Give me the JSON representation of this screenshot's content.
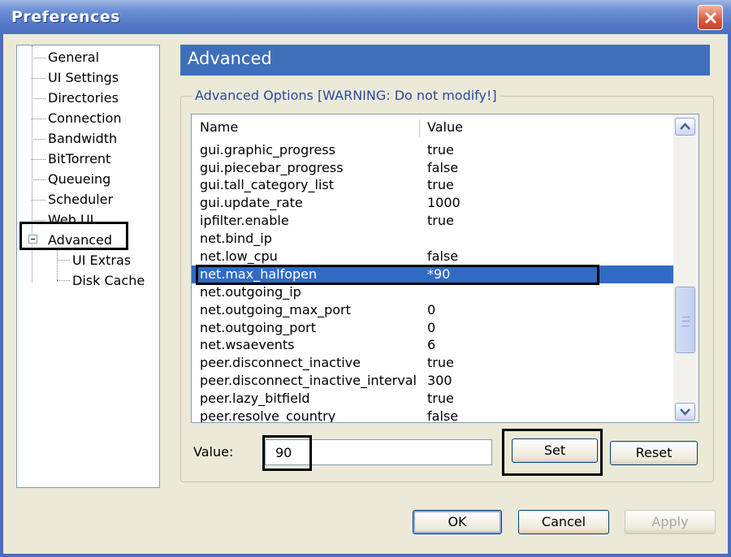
{
  "window": {
    "title": "Preferences"
  },
  "tree": {
    "items": [
      {
        "label": "General"
      },
      {
        "label": "UI Settings"
      },
      {
        "label": "Directories"
      },
      {
        "label": "Connection"
      },
      {
        "label": "Bandwidth"
      },
      {
        "label": "BitTorrent"
      },
      {
        "label": "Queueing"
      },
      {
        "label": "Scheduler"
      },
      {
        "label": "Web UI"
      },
      {
        "label": "Advanced"
      },
      {
        "label": "UI Extras"
      },
      {
        "label": "Disk Cache"
      }
    ]
  },
  "panel": {
    "title": "Advanced",
    "group_label": "Advanced Options [WARNING: Do not modify!]",
    "columns": {
      "name": "Name",
      "value": "Value"
    },
    "rows": [
      {
        "name": "gui.graphic_progress",
        "value": "true"
      },
      {
        "name": "gui.piecebar_progress",
        "value": "false"
      },
      {
        "name": "gui.tall_category_list",
        "value": "true"
      },
      {
        "name": "gui.update_rate",
        "value": "1000"
      },
      {
        "name": "ipfilter.enable",
        "value": "true"
      },
      {
        "name": "net.bind_ip",
        "value": ""
      },
      {
        "name": "net.low_cpu",
        "value": "false"
      },
      {
        "name": "net.max_halfopen",
        "value": "*90",
        "selected": true
      },
      {
        "name": "net.outgoing_ip",
        "value": ""
      },
      {
        "name": "net.outgoing_max_port",
        "value": "0"
      },
      {
        "name": "net.outgoing_port",
        "value": "0"
      },
      {
        "name": "net.wsaevents",
        "value": "6"
      },
      {
        "name": "peer.disconnect_inactive",
        "value": "true"
      },
      {
        "name": "peer.disconnect_inactive_interval",
        "value": "300"
      },
      {
        "name": "peer.lazy_bitfield",
        "value": "true"
      },
      {
        "name": "peer.resolve_country",
        "value": "false"
      }
    ],
    "value_label": "Value:",
    "value_input": "90",
    "set_button": "Set",
    "reset_button": "Reset"
  },
  "footer": {
    "ok": "OK",
    "cancel": "Cancel",
    "apply": "Apply"
  },
  "icons": {
    "close": "close-icon",
    "scroll_up": "chevron-up-icon",
    "scroll_down": "chevron-down-icon",
    "expander": "minus-box-icon"
  },
  "colors": {
    "selection": "#316ac5",
    "header": "#3f6fba",
    "titlebar": "#5579c6",
    "close": "#d8593b"
  }
}
